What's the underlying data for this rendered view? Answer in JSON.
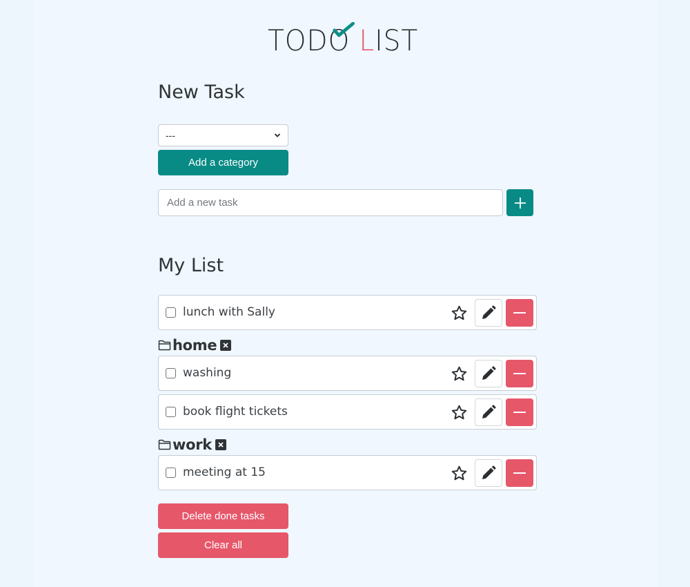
{
  "app": {
    "logo_parts": [
      "TOD",
      "O",
      " ",
      "L",
      "IST"
    ],
    "accent_teal": "#088a85",
    "accent_red": "#e6576a"
  },
  "new_task": {
    "heading": "New Task",
    "category_select": {
      "selected": "---"
    },
    "add_category_label": "Add a category",
    "task_input": {
      "value": "",
      "placeholder": "Add a new task"
    },
    "add_task_icon": "plus-icon"
  },
  "my_list": {
    "heading": "My List",
    "uncategorized": [
      {
        "label": "lunch with Sally",
        "done": false,
        "starred": false
      }
    ],
    "categories": [
      {
        "name": "home",
        "remove_icon": "x-icon",
        "tasks": [
          {
            "label": "washing",
            "done": false,
            "starred": false
          },
          {
            "label": "book flight tickets",
            "done": false,
            "starred": false
          }
        ]
      },
      {
        "name": "work",
        "remove_icon": "x-icon",
        "tasks": [
          {
            "label": "meeting at 15",
            "done": false,
            "starred": false
          }
        ]
      }
    ],
    "task_actions": {
      "star_icon": "star-outline-icon",
      "edit_icon": "pencil-icon",
      "delete_icon": "minus-icon"
    }
  },
  "footer": {
    "delete_done_label": "Delete done tasks",
    "clear_all_label": "Clear all"
  }
}
